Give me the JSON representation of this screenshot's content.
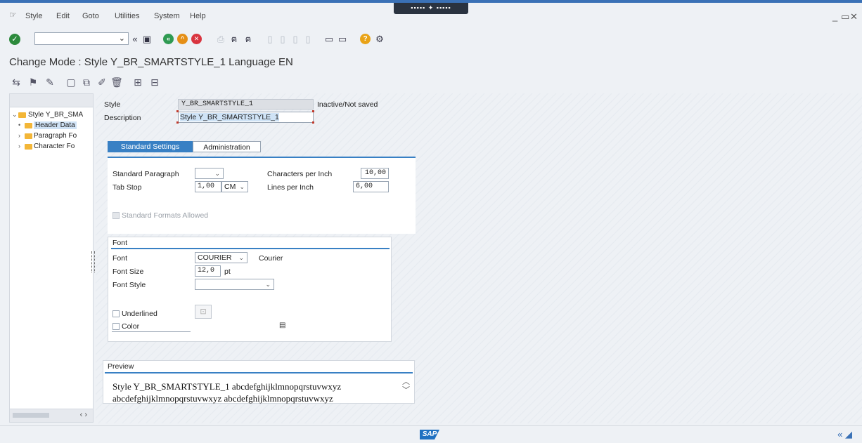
{
  "menubar": {
    "items": [
      "Style",
      "Edit",
      "Goto",
      "Utilities",
      "System",
      "Help"
    ]
  },
  "title": "Change Mode : Style Y_BR_SMARTSTYLE_1 Language EN",
  "tree": {
    "root": "Style Y_BR_SMA",
    "items": [
      "Header Data",
      "Paragraph Fo",
      "Character Fo"
    ]
  },
  "header": {
    "style_label": "Style",
    "style_value": "Y_BR_SMARTSTYLE_1",
    "status": "Inactive/Not saved",
    "description_label": "Description",
    "description_value": "Style Y_BR_SMARTSTYLE_1"
  },
  "tabs": [
    {
      "label": "Standard Settings",
      "active": true
    },
    {
      "label": "Administration",
      "active": false
    }
  ],
  "settings": {
    "std_paragraph_label": "Standard Paragraph",
    "std_paragraph_value": "",
    "tab_stop_label": "Tab Stop",
    "tab_stop_value": "1,00",
    "tab_stop_unit": "CM",
    "cpi_label": "Characters per Inch",
    "cpi_value": "10,00",
    "lpi_label": "Lines per Inch",
    "lpi_value": "6,00",
    "std_formats_label": "Standard Formats Allowed"
  },
  "font": {
    "group_title": "Font",
    "font_label": "Font",
    "font_value": "COURIER",
    "font_name": "Courier",
    "size_label": "Font Size",
    "size_value": "12,0",
    "size_unit": "pt",
    "style_label": "Font Style",
    "style_value": "",
    "underlined_label": "Underlined",
    "color_label": "Color"
  },
  "preview": {
    "title": "Preview",
    "text": "Style Y_BR_SMARTSTYLE_1 abcdefghijklmnopqrstuvwxyz abcdefghijklmnopqrstuvwxyz abcdefghijklmnopqrstuvwxyz"
  },
  "status": {
    "logo": "SAP"
  },
  "colors": {
    "accent": "#3880c4",
    "ok": "#2c8a3c",
    "folder": "#f3b637"
  }
}
